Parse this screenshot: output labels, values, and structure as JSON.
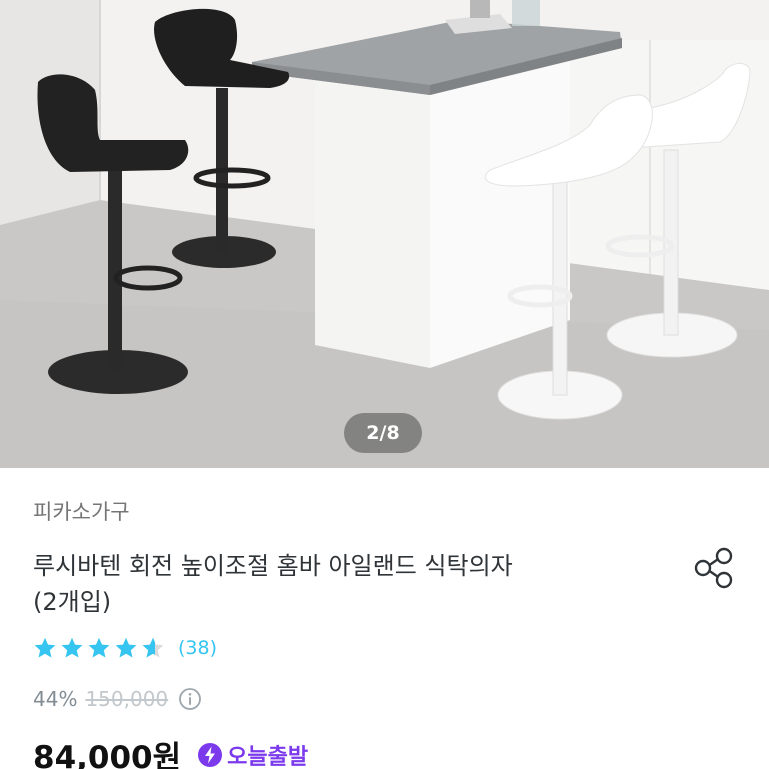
{
  "gallery": {
    "image_alt": "bar stools product photo",
    "current_page": "2/8"
  },
  "product": {
    "brand": "피카소가구",
    "title_line1": "루시바텐 회전 높이조절 홈바 아일랜드 식탁의자",
    "title_line2": "(2개입)",
    "rating": 4.6,
    "review_count": "(38)",
    "discount": "44%",
    "original_price": "150,000",
    "price": "84,000원",
    "delivery_label": "오늘출발"
  },
  "icons": {
    "share": "share-icon",
    "info": "info-icon",
    "star": "star-icon",
    "delivery": "lightning-bolt-icon"
  },
  "colors": {
    "accent": "#35c5f0",
    "delivery": "#7c3aed",
    "text": "#2f3438",
    "muted": "#828c94"
  }
}
